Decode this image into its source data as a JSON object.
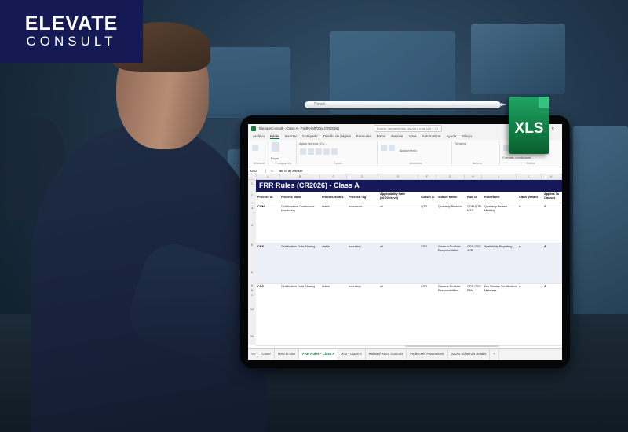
{
  "brand": {
    "logo_top": "ELEVATE",
    "logo_bottom": "CONSULT",
    "file_badge": "XLS",
    "pen_label": "Pencil"
  },
  "excel": {
    "window_title": "ElevateConsult - Class A - FedRAMP20x (CR2026)",
    "search_placeholder": "Buscar herramientas, ayuda y más (Alt + Q)",
    "menu": [
      "Archivo",
      "Inicio",
      "Insertar",
      "Compartir",
      "Diseño de página",
      "Fórmulas",
      "Datos",
      "Revisar",
      "Vista",
      "Automatizar",
      "Ayuda",
      "Dibujo"
    ],
    "active_menu": "Inicio",
    "ribbon_groups": [
      {
        "name": "Deshacer",
        "label": ""
      },
      {
        "name": "Portapapeles",
        "label": "Pegar"
      },
      {
        "name": "Fuente",
        "label": "Aptos Narrow (Cu..."
      },
      {
        "name": "Alineación",
        "label": "Ajustar texto"
      },
      {
        "name": "Número",
        "label": "General"
      },
      {
        "name": "Estilos",
        "label": "Formato condicional"
      }
    ],
    "name_box": "A202",
    "formula_hint": "Talk to an advisor",
    "column_letters": [
      "A",
      "B",
      "C",
      "D",
      "E",
      "F",
      "G",
      "H",
      "I",
      "J",
      "K"
    ],
    "sheet_banner": "FRR Rules (CR2026) - Class A",
    "headers": [
      "Process ID",
      "Process Name",
      "Process Status",
      "Process Tag",
      "Applicability Path (all,20x/rev5)",
      "Subset ID",
      "Subset Name",
      "Rule ID",
      "Rule Name",
      "Class Variant",
      "Applies To Classes"
    ],
    "rows": [
      {
        "process_id": "COM",
        "process_name": "Collaborative Continuous Monitoring",
        "status": "stable",
        "tag": "assurance",
        "applicability": "all",
        "subset_id": "QTR",
        "subset_name": "Quarterly Reviews",
        "rule_id": "COM-QTR-MTG",
        "rule_name": "Quarterly Review Meeting",
        "class_variant": "A",
        "applies_to": "A"
      },
      {
        "process_id": "CDS",
        "process_name": "Certification Data Sharing",
        "status": "stable",
        "tag": "boundary",
        "applicability": "all",
        "subset_id": "CSO",
        "subset_name": "General Provider Responsibilities",
        "rule_id": "CDS-CSO-AVR",
        "rule_name": "Availability Reporting",
        "class_variant": "A",
        "applies_to": "A"
      },
      {
        "process_id": "CDS",
        "process_name": "Certification Data Sharing",
        "status": "stable",
        "tag": "boundary",
        "applicability": "all",
        "subset_id": "CSO",
        "subset_name": "General Provider Responsibilities",
        "rule_id": "CDS-CSO-PSM",
        "rule_name": "Per Service Certification Materials",
        "class_variant": "A",
        "applies_to": "A"
      }
    ],
    "row_numbers": [
      "1",
      "2",
      "3",
      "4",
      "5",
      "6",
      "9",
      "8",
      "9",
      "30",
      "11"
    ],
    "sheet_tabs": [
      "Cover",
      "How to Use",
      "FRR Rules - Class A",
      "KSI - Class A",
      "Related RevS Controls",
      "FedRAMP Parameters",
      "JSON Schemas Details"
    ],
    "active_tab": "FRR Rules - Class A"
  }
}
